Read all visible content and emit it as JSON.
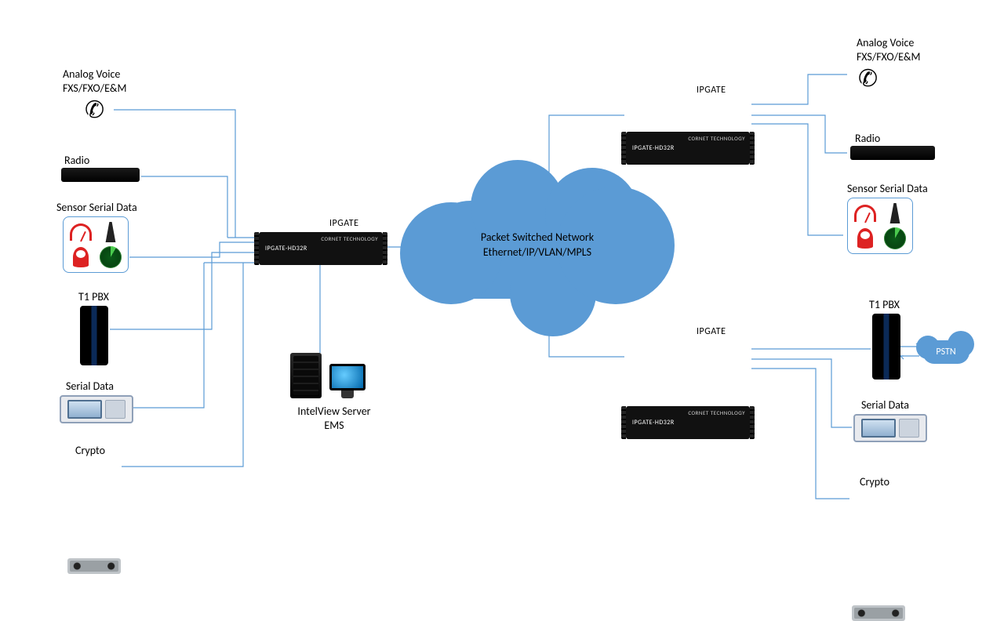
{
  "cloud": {
    "line1": "Packet Switched Network",
    "line2": "Ethernet/IP/VLAN/MPLS"
  },
  "pstn": {
    "label": "PSTN"
  },
  "ems": {
    "line1": "IntelView Server",
    "line2": "EMS"
  },
  "gateway": {
    "title": "IPGATE",
    "model": "IPGATE-HD32R",
    "vendor": "CORNET TECHNOLOGY"
  },
  "left": {
    "analog": {
      "line1": "Analog Voice",
      "line2": "FXS/FXO/E&M"
    },
    "radio": "Radio",
    "sensor": "Sensor Serial Data",
    "t1pbx": "T1 PBX",
    "serial": "Serial Data",
    "crypto": "Crypto"
  },
  "right": {
    "analog": {
      "line1": "Analog Voice",
      "line2": "FXS/FXO/E&M"
    },
    "radio": "Radio",
    "sensor": "Sensor Serial Data",
    "t1pbx": "T1 PBX",
    "serial": "Serial Data",
    "crypto": "Crypto"
  }
}
